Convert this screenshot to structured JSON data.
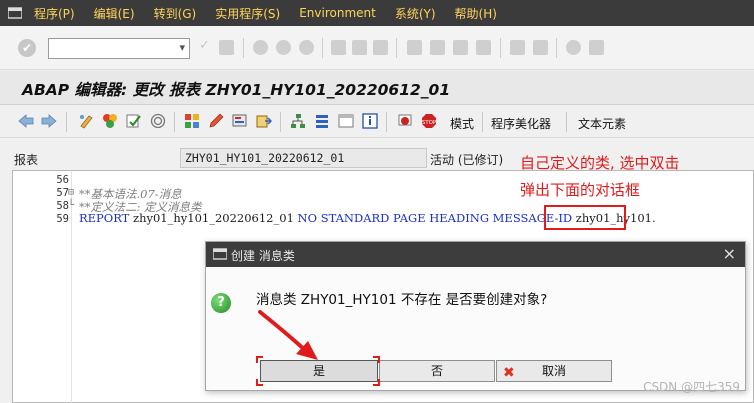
{
  "menu": {
    "items": [
      "程序(P)",
      "编辑(E)",
      "转到(G)",
      "实用程序(S)",
      "Environment",
      "系统(Y)",
      "帮助(H)"
    ]
  },
  "title": "ABAP 编辑器: 更改 报表 ZHY01_HY101_20220612_01",
  "app_toolbar": {
    "mode_label": "模式",
    "pretty_printer_label": "程序美化器",
    "text_elements_label": "文本元素"
  },
  "report": {
    "label": "报表",
    "name": "ZHY01_HY101_20220612_01",
    "status": "活动 (已修订)"
  },
  "editor": {
    "lines": [
      {
        "num": "56",
        "fold": "",
        "text": ""
      },
      {
        "num": "57",
        "fold": "⊟",
        "text": "**基本语法.07-消息"
      },
      {
        "num": "58",
        "fold": "└",
        "text": "**定义法二: 定义消息类"
      },
      {
        "num": "59",
        "fold": "",
        "kw1": "REPORT",
        "t1": " zhy01_hy101_20220612_01 ",
        "kw2": "NO STANDARD PAGE HEADING MESSAGE-ID",
        "t2": " zhy01_hy101."
      }
    ]
  },
  "annotation": {
    "line1": "自己定义的类, 选中双击",
    "line2": "弹出下面的对话框"
  },
  "dialog": {
    "title": "创建 消息类",
    "message": "消息类 ZHY01_HY101 不存在 是否要创建对象?",
    "yes_label": "是",
    "no_label": "否",
    "cancel_label": "取消"
  },
  "watermark": "CSDN @四七359",
  "colors": {
    "menubar_bg": "#3b3b3b",
    "menu_text": "#ffd35a",
    "annotation_red": "#e01b1b",
    "keyword_blue": "#1b2fd0"
  }
}
